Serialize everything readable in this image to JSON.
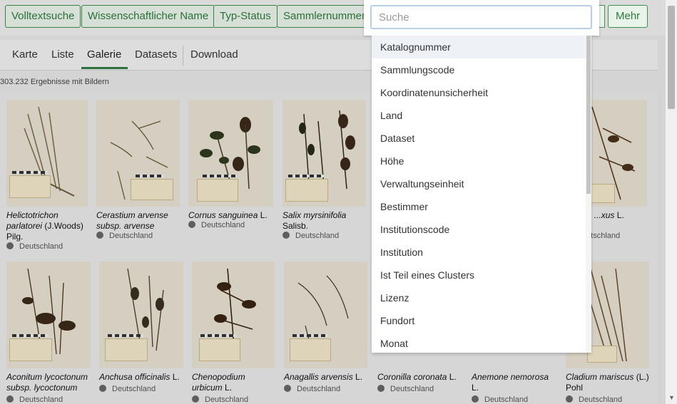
{
  "filters": [
    "Volltextsuche",
    "Wissenschaftlicher Name",
    "Typ-Status",
    "Sammlernummer"
  ],
  "more_label": "Mehr",
  "tabs": [
    "Karte",
    "Liste",
    "Galerie",
    "Datasets",
    "Download"
  ],
  "active_tab": "Galerie",
  "results_text": "303.232 Ergebnisse mit Bildern",
  "search": {
    "placeholder": "Suche",
    "value": ""
  },
  "menu_items": [
    "Katalognummer",
    "Sammlungscode",
    "Koordinatenunsicherheit",
    "Land",
    "Dataset",
    "Höhe",
    "Verwaltungseinheit",
    "Bestimmer",
    "Institutionscode",
    "Institution",
    "Ist Teil eines Clusters",
    "Lizenz",
    "Fundort",
    "Monat"
  ],
  "hovered_item": "Katalognummer",
  "row1": [
    {
      "name_italic": "Helictotrichon parlatorei",
      "name_rest": " (J.Woods) Pilg.",
      "location": "Deutschland"
    },
    {
      "name_italic": "Cerastium arvense subsp. arvense",
      "name_rest": "",
      "location": "Deutschland"
    },
    {
      "name_italic": "Cornus sanguinea",
      "name_rest": " L.",
      "location": "Deutschland"
    },
    {
      "name_italic": "Salix myrsinifolia",
      "name_rest": " Salisb.",
      "location": "Deutschland"
    },
    {
      "name_italic": "...nthus ...xus",
      "name_rest": " L.",
      "location": "Deutschland"
    }
  ],
  "row2": [
    {
      "name_italic": "Aconitum lycoctonum subsp. lycoctonum",
      "name_rest": "",
      "location": "Deutschland"
    },
    {
      "name_italic": "Anchusa officinalis",
      "name_rest": " L.",
      "location": "Deutschland"
    },
    {
      "name_italic": "Chenopodium urbicum",
      "name_rest": " L.",
      "location": "Deutschland"
    },
    {
      "name_italic": "Anagallis arvensis",
      "name_rest": " L.",
      "location": "Deutschland"
    },
    {
      "name_italic": "Coronilla coronata",
      "name_rest": " L.",
      "location": "Deutschland"
    },
    {
      "name_italic": "Anemone nemorosa",
      "name_rest": " L.",
      "location": "Deutschland"
    },
    {
      "name_italic": "Cladium mariscus",
      "name_rest": " (L.) Pohl",
      "location": "Deutschland"
    }
  ]
}
